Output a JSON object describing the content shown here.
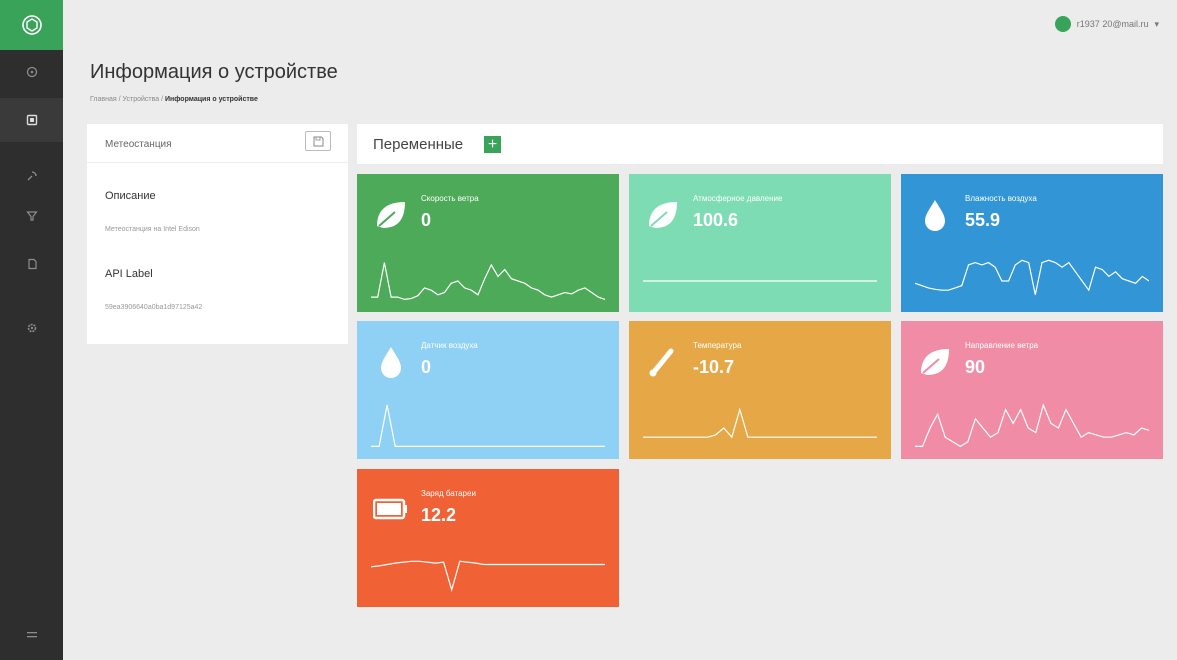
{
  "user": {
    "name": "r1937 20@mail.ru"
  },
  "page": {
    "title": "Информация о устройстве",
    "breadcrumb": [
      "Главная",
      "Устройства",
      "Информация о устройстве"
    ],
    "breadcrumb_sep": "/"
  },
  "device": {
    "header": "Метеостанция",
    "fields": [
      {
        "label": "Описание",
        "value": "Метеостанция на Intel Edison"
      },
      {
        "label": "API Label",
        "value": "59ea3906640a0ba1d97125a42"
      }
    ]
  },
  "variables": {
    "title": "Переменные",
    "add_label": "+",
    "tiles": [
      {
        "label": "Скорость ветра",
        "value": "0",
        "color": "#4caa58",
        "icon": "leaf-icon",
        "spark": [
          0.15,
          0.15,
          0.9,
          0.15,
          0.15,
          0.1,
          0.12,
          0.18,
          0.35,
          0.3,
          0.2,
          0.25,
          0.45,
          0.5,
          0.35,
          0.3,
          0.2,
          0.55,
          0.85,
          0.6,
          0.75,
          0.55,
          0.5,
          0.45,
          0.35,
          0.3,
          0.2,
          0.15,
          0.2,
          0.25,
          0.22,
          0.3,
          0.35,
          0.25,
          0.15,
          0.1
        ]
      },
      {
        "label": "Атмосферное давление",
        "value": "100.6",
        "color": "#7ddcb4",
        "icon": "leaf-icon",
        "spark": [
          0.5,
          0.5,
          0.5,
          0.5,
          0.5,
          0.5,
          0.5,
          0.5,
          0.5,
          0.5,
          0.5,
          0.5,
          0.5,
          0.5,
          0.5,
          0.5,
          0.5,
          0.5,
          0.5,
          0.5,
          0.5,
          0.5,
          0.5,
          0.5,
          0.5,
          0.5,
          0.5,
          0.5,
          0.5,
          0.5
        ]
      },
      {
        "label": "Влажность воздуха",
        "value": "55.9",
        "color": "#3195d6",
        "icon": "drop-icon",
        "spark": [
          0.45,
          0.4,
          0.35,
          0.32,
          0.3,
          0.3,
          0.35,
          0.4,
          0.85,
          0.9,
          0.85,
          0.9,
          0.8,
          0.5,
          0.5,
          0.85,
          0.95,
          0.9,
          0.2,
          0.9,
          0.95,
          0.9,
          0.8,
          0.9,
          0.7,
          0.5,
          0.3,
          0.8,
          0.75,
          0.6,
          0.7,
          0.55,
          0.5,
          0.45,
          0.6,
          0.5
        ]
      },
      {
        "label": "Датчик воздуха",
        "value": "0",
        "color": "#8ed1f5",
        "icon": "drop-icon",
        "spark": [
          0.1,
          0.1,
          1.0,
          0.1,
          0.1,
          0.1,
          0.1,
          0.1,
          0.1,
          0.1,
          0.1,
          0.1,
          0.1,
          0.1,
          0.1,
          0.1,
          0.1,
          0.1,
          0.1,
          0.1,
          0.1,
          0.1,
          0.1,
          0.1,
          0.1,
          0.1,
          0.1,
          0.1,
          0.1,
          0.1
        ]
      },
      {
        "label": "Температура",
        "value": "-10.7",
        "color": "#e6a847",
        "icon": "thermometer-icon",
        "spark": [
          0.3,
          0.3,
          0.3,
          0.3,
          0.3,
          0.3,
          0.3,
          0.3,
          0.3,
          0.35,
          0.5,
          0.3,
          0.9,
          0.3,
          0.3,
          0.3,
          0.3,
          0.3,
          0.3,
          0.3,
          0.3,
          0.3,
          0.3,
          0.3,
          0.3,
          0.3,
          0.3,
          0.3,
          0.3,
          0.3
        ]
      },
      {
        "label": "Направление ветра",
        "value": "90",
        "color": "#f08ca6",
        "icon": "leaf-icon",
        "spark": [
          0.1,
          0.1,
          0.5,
          0.8,
          0.3,
          0.2,
          0.1,
          0.2,
          0.7,
          0.5,
          0.3,
          0.4,
          0.9,
          0.6,
          0.9,
          0.5,
          0.4,
          1.0,
          0.6,
          0.5,
          0.9,
          0.6,
          0.3,
          0.4,
          0.35,
          0.3,
          0.3,
          0.35,
          0.4,
          0.35,
          0.5,
          0.45
        ]
      },
      {
        "label": "Заряд батареи",
        "value": "12.2",
        "color": "#f06135",
        "icon": "battery-icon",
        "spark": [
          0.7,
          0.72,
          0.75,
          0.78,
          0.8,
          0.82,
          0.82,
          0.8,
          0.78,
          0.8,
          0.2,
          0.82,
          0.8,
          0.78,
          0.75,
          0.75,
          0.75,
          0.75,
          0.75,
          0.75,
          0.75,
          0.75,
          0.75,
          0.75,
          0.75,
          0.75,
          0.75,
          0.75,
          0.75,
          0.75
        ]
      }
    ]
  }
}
